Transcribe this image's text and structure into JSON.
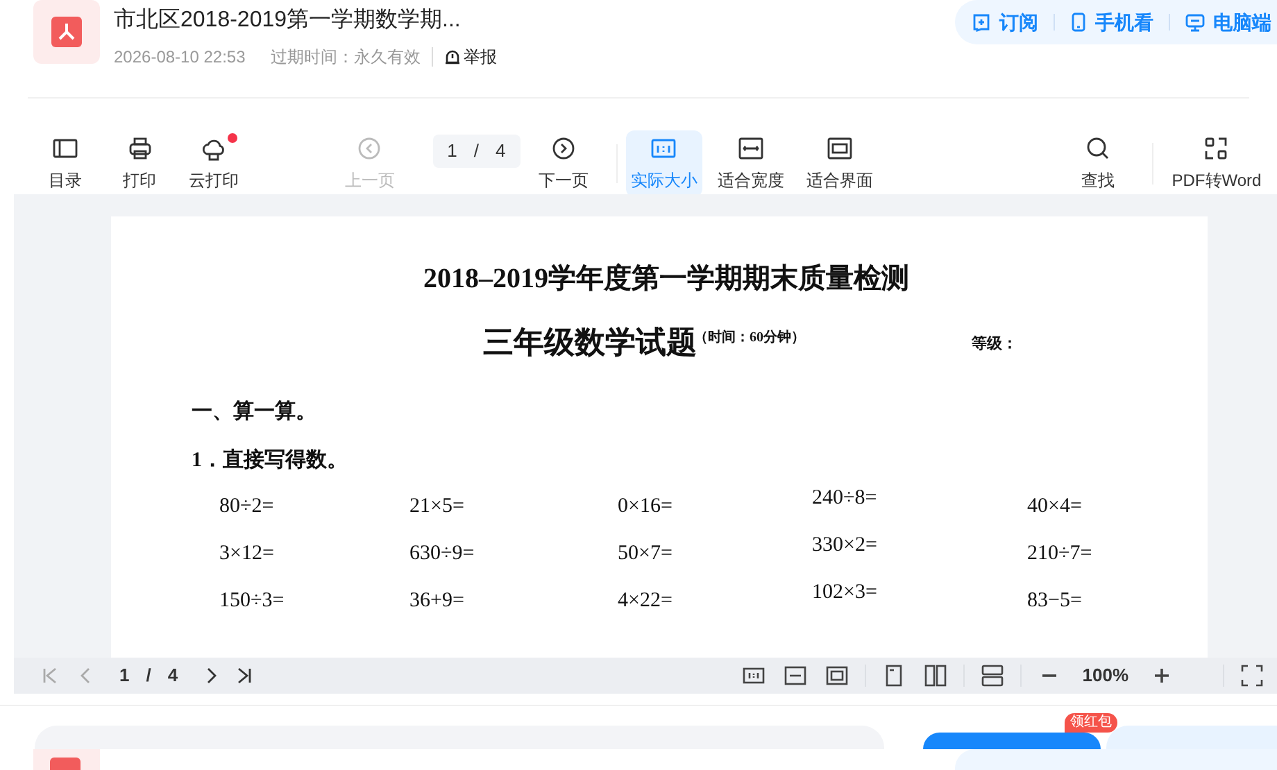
{
  "header": {
    "title": "市北区2018-2019第一学期数学期...",
    "date": "2026-08-10 22:53",
    "expiry": "过期时间：永久有效",
    "report": "举报"
  },
  "top_actions": [
    {
      "label": "订阅",
      "kind": "subscribe"
    },
    {
      "label": "手机看",
      "kind": "phone"
    },
    {
      "label": "电脑端",
      "kind": "desktop"
    }
  ],
  "toolbar": [
    {
      "label": "目录",
      "kind": "outline",
      "disabled": false,
      "selected": false,
      "dot": false
    },
    {
      "label": "打印",
      "kind": "print",
      "disabled": false,
      "selected": false,
      "dot": false
    },
    {
      "label": "云打印",
      "kind": "cloud",
      "disabled": false,
      "selected": false,
      "dot": true
    },
    {
      "label": "上一页",
      "kind": "prev",
      "disabled": true,
      "selected": false,
      "dot": false
    },
    {
      "kind": "pager",
      "current": "1",
      "separator": "/",
      "total": "4"
    },
    {
      "label": "下一页",
      "kind": "next",
      "disabled": false,
      "selected": false,
      "dot": false
    },
    {
      "label": "实际大小",
      "kind": "actual",
      "disabled": false,
      "selected": true,
      "dot": false
    },
    {
      "label": "适合宽度",
      "kind": "width",
      "disabled": false,
      "selected": false,
      "dot": false
    },
    {
      "label": "适合界面",
      "kind": "fit",
      "disabled": false,
      "selected": false,
      "dot": false
    },
    {
      "label": "查找",
      "kind": "search",
      "disabled": false,
      "selected": false,
      "dot": false
    },
    {
      "label": "PDF转Word",
      "kind": "convert",
      "disabled": false,
      "selected": false,
      "dot": false
    }
  ],
  "document": {
    "title": "2018–2019学年度第一学期期末质量检测",
    "subtitle": "三年级数学试题",
    "time_note": "（时间：60分钟）",
    "grade_label": "等级：",
    "section": "一、算一算。",
    "question": "1．直接写得数。",
    "rows": [
      [
        "80÷2=",
        "21×5=",
        "0×16=",
        "240÷8=",
        "40×4="
      ],
      [
        "3×12=",
        "630÷9=",
        "50×7=",
        "330×2=",
        "210÷7="
      ],
      [
        "150÷3=",
        "36+9=",
        "4×22=",
        "102×3=",
        "83−5="
      ]
    ]
  },
  "bottom_bar": {
    "current": "1",
    "separator": "/",
    "total": "4",
    "zoom": "100%"
  },
  "promo_badge": "领红包"
}
